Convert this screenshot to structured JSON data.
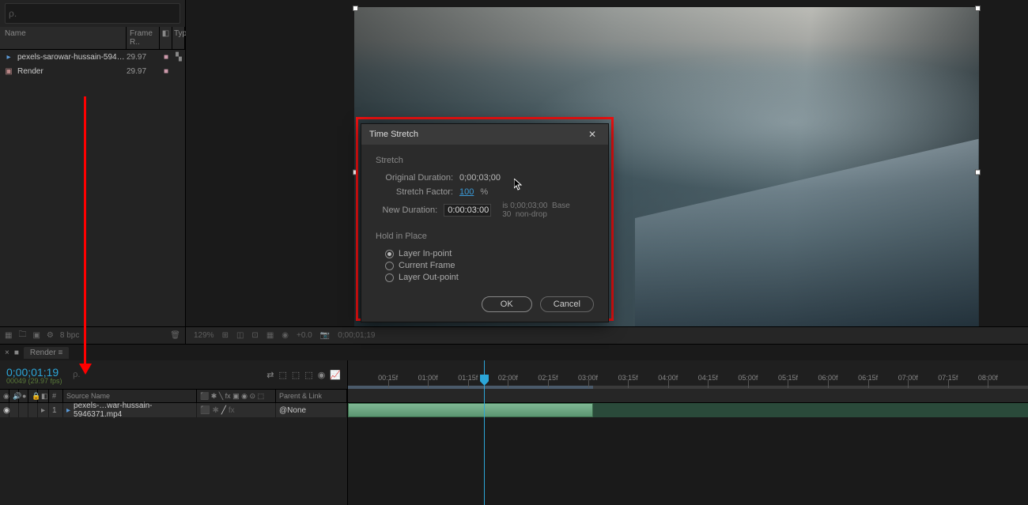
{
  "project": {
    "search_placeholder": "ρ.",
    "columns": {
      "name": "Name",
      "frame_rate": "Frame R..",
      "type": "Typ"
    },
    "items": [
      {
        "icon": "footage-icon",
        "name": "pexels-sarowar-hussain-5946371.mp4",
        "frame_rate": "29.97",
        "has_label": true,
        "type_glyph": "▚"
      },
      {
        "icon": "comp-icon",
        "name": "Render",
        "frame_rate": "29.97",
        "has_label": true,
        "type_glyph": ""
      }
    ],
    "footer_bpc": "8 bpc"
  },
  "comp_toolbar": {
    "zoom": "129%",
    "exposure": "+0.0",
    "timecode": "0;00;01;19"
  },
  "timeline": {
    "tab_label": "Render",
    "timecode": "0;00;01;19",
    "timecode_sub": "00049 (29.97 fps)",
    "columns": {
      "num": "#",
      "source": "Source Name",
      "parent": "Parent & Link"
    },
    "layer": {
      "num": "1",
      "name": "pexels-…war-hussain-5946371.mp4",
      "parent": "None"
    },
    "ticks": [
      "00:15f",
      "01:00f",
      "01:15f",
      "02:00f",
      "02:15f",
      "03:00f",
      "03:15f",
      "04:00f",
      "04:15f",
      "05:00f",
      "05:15f",
      "06:00f",
      "06:15f",
      "07:00f",
      "07:15f",
      "08:00f"
    ]
  },
  "dialog": {
    "title": "Time Stretch",
    "group_stretch": "Stretch",
    "orig_label": "Original Duration:",
    "orig_value": "0;00;03;00",
    "factor_label": "Stretch Factor:",
    "factor_value": "100",
    "factor_suffix": "%",
    "newdur_label": "New Duration:",
    "newdur_value": "0:00:03:00",
    "newdur_extra1": "is 0;00;03;00",
    "newdur_extra2": "Base 30",
    "newdur_extra3": "non-drop",
    "group_hold": "Hold in Place",
    "hold_opts": [
      "Layer In-point",
      "Current Frame",
      "Layer Out-point"
    ],
    "hold_selected": 0,
    "ok": "OK",
    "cancel": "Cancel"
  }
}
